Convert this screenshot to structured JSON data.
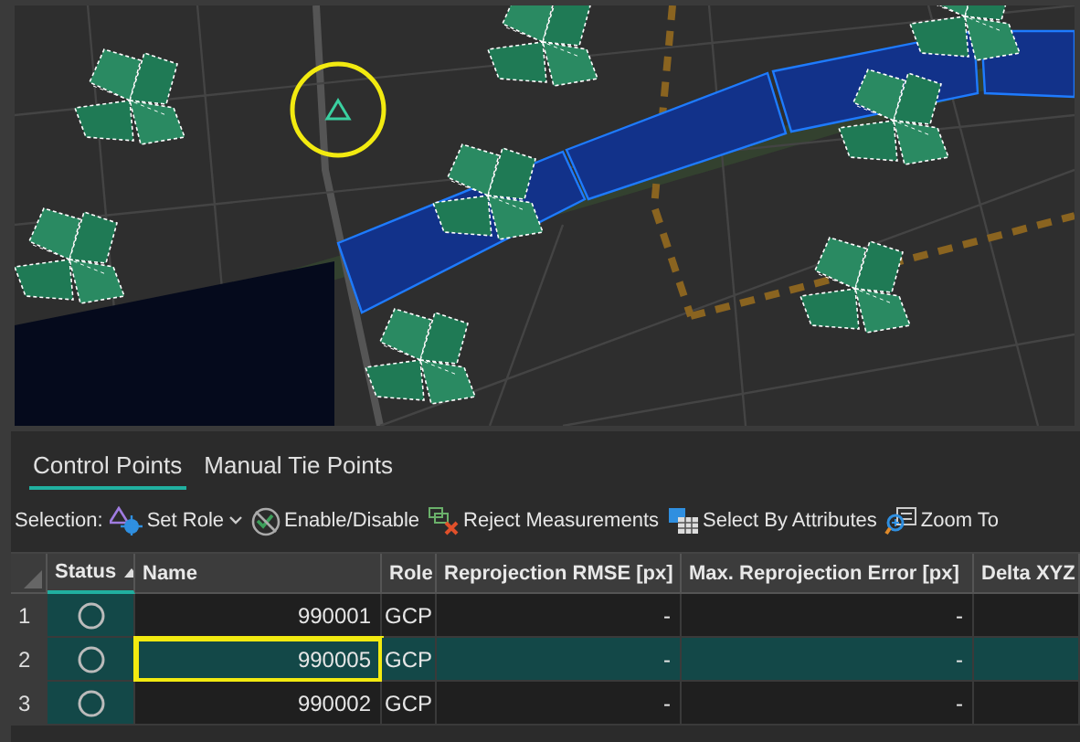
{
  "tabs": [
    {
      "label": "Control Points",
      "selected": true
    },
    {
      "label": "Manual Tie Points",
      "selected": false
    }
  ],
  "toolbar": {
    "label": "Selection:",
    "buttons": [
      {
        "kind": "role",
        "label": "Set Role",
        "dropdown": true
      },
      {
        "kind": "enable",
        "label": "Enable/Disable",
        "dropdown": false
      },
      {
        "kind": "reject",
        "label": "Reject Measurements",
        "dropdown": false
      },
      {
        "kind": "select",
        "label": "Select By Attributes",
        "dropdown": false
      },
      {
        "kind": "zoom",
        "label": "Zoom To",
        "dropdown": false
      }
    ]
  },
  "table": {
    "columns": [
      {
        "label": "Status",
        "sorted": true
      },
      {
        "label": "Name",
        "sorted": false
      },
      {
        "label": "Role",
        "sorted": false
      },
      {
        "label": "Reprojection RMSE [px]",
        "sorted": false
      },
      {
        "label": "Max. Reprojection Error [px]",
        "sorted": false
      },
      {
        "label": "Delta XYZ",
        "sorted": false
      }
    ],
    "rows": [
      {
        "number": "1",
        "name": "990001",
        "role": "GCP",
        "rmse": "-",
        "max_error": "-",
        "selected": false,
        "highlighted": false
      },
      {
        "number": "2",
        "name": "990005",
        "role": "GCP",
        "rmse": "-",
        "max_error": "-",
        "selected": true,
        "highlighted": true
      },
      {
        "number": "3",
        "name": "990002",
        "role": "GCP",
        "rmse": "-",
        "max_error": "-",
        "selected": false,
        "highlighted": false
      }
    ]
  }
}
